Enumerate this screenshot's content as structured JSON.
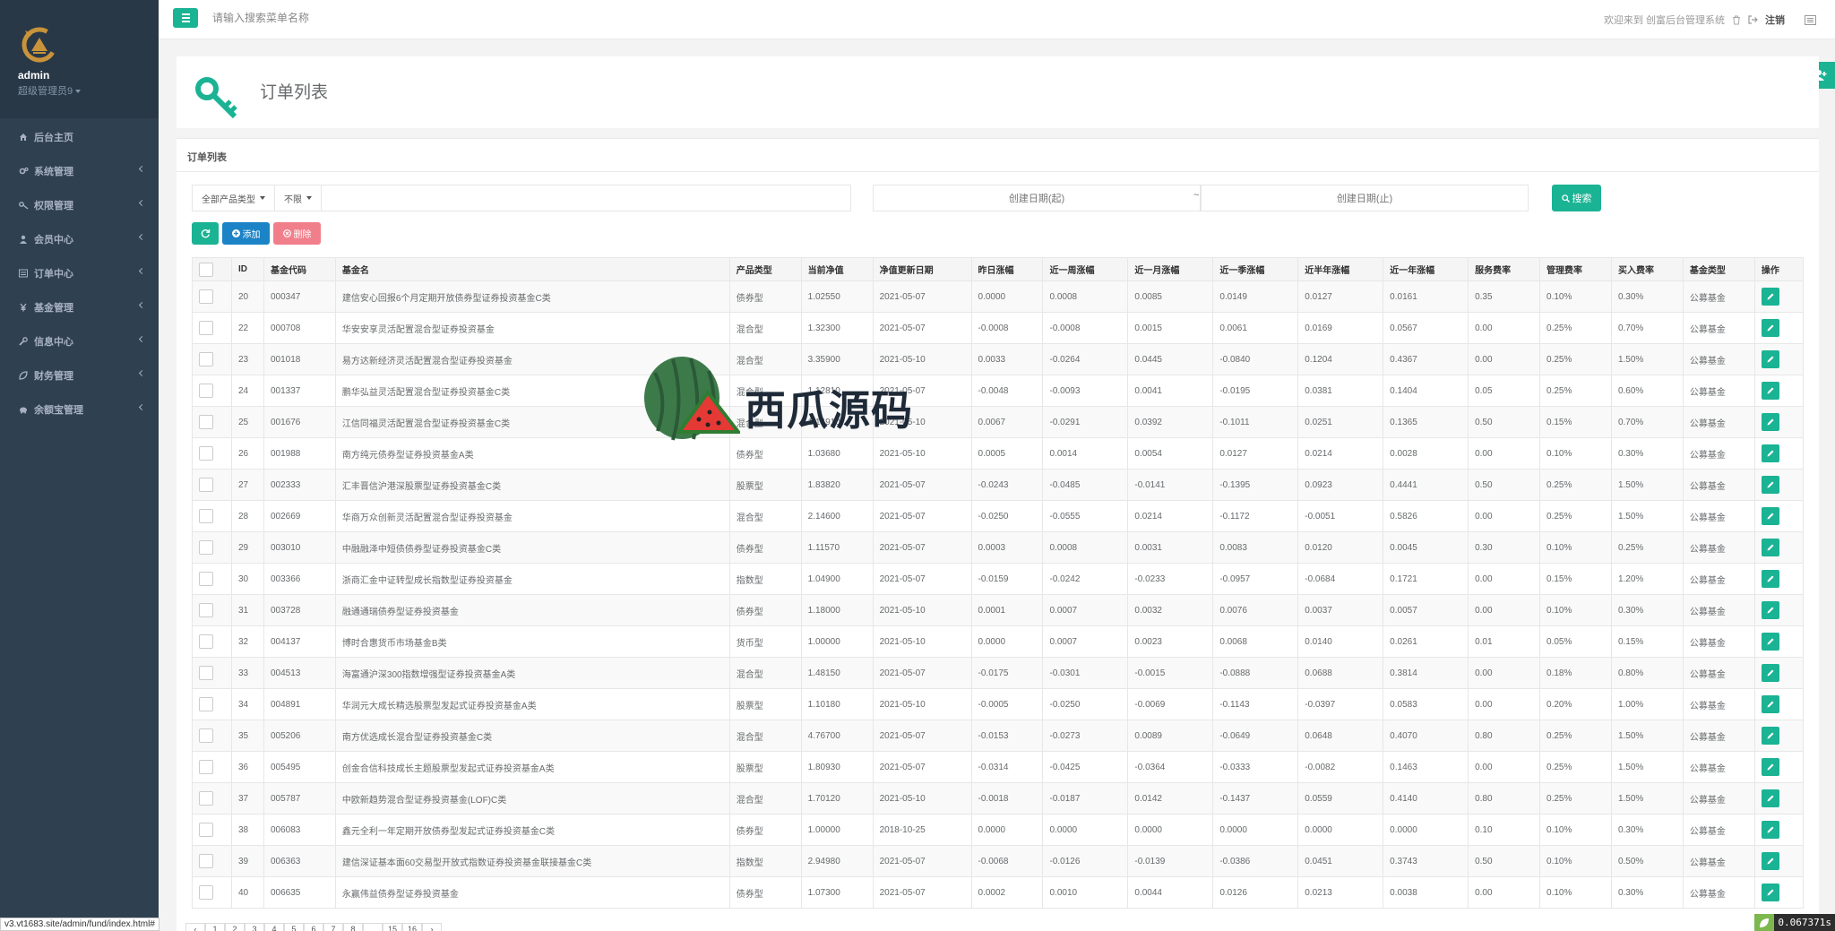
{
  "sidebar": {
    "user_name": "admin",
    "user_role": "超级管理员9",
    "items": [
      {
        "label": "后台主页",
        "icon": "home-icon",
        "chev": false
      },
      {
        "label": "系统管理",
        "icon": "cogs-icon",
        "chev": true
      },
      {
        "label": "权限管理",
        "icon": "key-icon",
        "chev": true
      },
      {
        "label": "会员中心",
        "icon": "user-icon",
        "chev": true
      },
      {
        "label": "订单中心",
        "icon": "list-icon",
        "chev": true
      },
      {
        "label": "基金管理",
        "icon": "yen-icon",
        "chev": true
      },
      {
        "label": "信息中心",
        "icon": "wrench-icon",
        "chev": true
      },
      {
        "label": "财务管理",
        "icon": "leaf-icon",
        "chev": true
      },
      {
        "label": "余额宝管理",
        "icon": "piggy-icon",
        "chev": true
      }
    ]
  },
  "status_url": "v3.vt1683.site/admin/fund/index.html#",
  "topbar": {
    "search_placeholder": "请输入搜索菜单名称",
    "welcome": "欢迎来到 创富后台管理系统",
    "logout": "注销"
  },
  "page": {
    "title": "订单列表",
    "panel_title": "订单列表"
  },
  "filters": {
    "product_type": "全部产品类型",
    "limit": "不限",
    "date_start": "创建日期(起)",
    "date_tilde": "~",
    "date_end": "创建日期(止)",
    "search_label": "搜索"
  },
  "toolbar": {
    "add_label": "添加",
    "delete_label": "删除"
  },
  "table": {
    "headers": [
      "ID",
      "基金代码",
      "基金名",
      "产品类型",
      "当前净值",
      "净值更新日期",
      "昨日涨幅",
      "近一周涨幅",
      "近一月涨幅",
      "近一季涨幅",
      "近半年涨幅",
      "近一年涨幅",
      "服务费率",
      "管理费率",
      "买入费率",
      "基金类型",
      "操作"
    ],
    "rows": [
      [
        "20",
        "000347",
        "建信安心回报6个月定期开放债券型证券投资基金C类",
        "债券型",
        "1.02550",
        "2021-05-07",
        "0.0000",
        "0.0008",
        "0.0085",
        "0.0149",
        "0.0127",
        "0.0161",
        "0.35",
        "0.10%",
        "0.30%",
        "公募基金"
      ],
      [
        "22",
        "000708",
        "华安安享灵活配置混合型证券投资基金",
        "混合型",
        "1.32300",
        "2021-05-07",
        "-0.0008",
        "-0.0008",
        "0.0015",
        "0.0061",
        "0.0169",
        "0.0567",
        "0.00",
        "0.25%",
        "0.70%",
        "公募基金"
      ],
      [
        "23",
        "001018",
        "易方达新经济灵活配置混合型证券投资基金",
        "混合型",
        "3.35900",
        "2021-05-10",
        "0.0033",
        "-0.0264",
        "0.0445",
        "-0.0840",
        "0.1204",
        "0.4367",
        "0.00",
        "0.25%",
        "1.50%",
        "公募基金"
      ],
      [
        "24",
        "001337",
        "鹏华弘益灵活配置混合型证券投资基金C类",
        "混合型",
        "1.12810",
        "2021-05-07",
        "-0.0048",
        "-0.0093",
        "0.0041",
        "-0.0195",
        "0.0381",
        "0.1404",
        "0.05",
        "0.25%",
        "0.60%",
        "公募基金"
      ],
      [
        "25",
        "001676",
        "江信同福灵活配置混合型证券投资基金C类",
        "混合型",
        "1.14910",
        "2021-05-10",
        "0.0067",
        "-0.0291",
        "0.0392",
        "-0.1011",
        "0.0251",
        "0.1365",
        "0.50",
        "0.15%",
        "0.70%",
        "公募基金"
      ],
      [
        "26",
        "001988",
        "南方纯元债券型证券投资基金A类",
        "债券型",
        "1.03680",
        "2021-05-10",
        "0.0005",
        "0.0014",
        "0.0054",
        "0.0127",
        "0.0214",
        "0.0028",
        "0.00",
        "0.10%",
        "0.30%",
        "公募基金"
      ],
      [
        "27",
        "002333",
        "汇丰晋信沪港深股票型证券投资基金C类",
        "股票型",
        "1.83820",
        "2021-05-07",
        "-0.0243",
        "-0.0485",
        "-0.0141",
        "-0.1395",
        "0.0923",
        "0.4441",
        "0.50",
        "0.25%",
        "1.50%",
        "公募基金"
      ],
      [
        "28",
        "002669",
        "华商万众创新灵活配置混合型证券投资基金",
        "混合型",
        "2.14600",
        "2021-05-07",
        "-0.0250",
        "-0.0555",
        "0.0214",
        "-0.1172",
        "-0.0051",
        "0.5826",
        "0.00",
        "0.25%",
        "1.50%",
        "公募基金"
      ],
      [
        "29",
        "003010",
        "中融融泽中短债债券型证券投资基金C类",
        "债券型",
        "1.11570",
        "2021-05-07",
        "0.0003",
        "0.0008",
        "0.0031",
        "0.0083",
        "0.0120",
        "0.0045",
        "0.30",
        "0.10%",
        "0.25%",
        "公募基金"
      ],
      [
        "30",
        "003366",
        "浙商汇金中证转型成长指数型证券投资基金",
        "指数型",
        "1.04900",
        "2021-05-07",
        "-0.0159",
        "-0.0242",
        "-0.0233",
        "-0.0957",
        "-0.0684",
        "0.1721",
        "0.00",
        "0.15%",
        "1.20%",
        "公募基金"
      ],
      [
        "31",
        "003728",
        "融通通瑞债券型证券投资基金",
        "债券型",
        "1.18000",
        "2021-05-10",
        "0.0001",
        "0.0007",
        "0.0032",
        "0.0076",
        "0.0037",
        "0.0057",
        "0.00",
        "0.10%",
        "0.30%",
        "公募基金"
      ],
      [
        "32",
        "004137",
        "博时合惠货币市场基金B类",
        "货币型",
        "1.00000",
        "2021-05-10",
        "0.0000",
        "0.0007",
        "0.0023",
        "0.0068",
        "0.0140",
        "0.0261",
        "0.01",
        "0.05%",
        "0.15%",
        "公募基金"
      ],
      [
        "33",
        "004513",
        "海富通沪深300指数增强型证券投资基金A类",
        "混合型",
        "1.48150",
        "2021-05-07",
        "-0.0175",
        "-0.0301",
        "-0.0015",
        "-0.0888",
        "0.0688",
        "0.3814",
        "0.00",
        "0.18%",
        "0.80%",
        "公募基金"
      ],
      [
        "34",
        "004891",
        "华润元大成长精选股票型发起式证券投资基金A类",
        "股票型",
        "1.10180",
        "2021-05-10",
        "-0.0005",
        "-0.0250",
        "-0.0069",
        "-0.1143",
        "-0.0397",
        "0.0583",
        "0.00",
        "0.20%",
        "1.00%",
        "公募基金"
      ],
      [
        "35",
        "005206",
        "南方优选成长混合型证券投资基金C类",
        "混合型",
        "4.76700",
        "2021-05-07",
        "-0.0153",
        "-0.0273",
        "0.0089",
        "-0.0649",
        "0.0648",
        "0.4070",
        "0.80",
        "0.25%",
        "1.50%",
        "公募基金"
      ],
      [
        "36",
        "005495",
        "创金合信科技成长主题股票型发起式证券投资基金A类",
        "股票型",
        "1.80930",
        "2021-05-07",
        "-0.0314",
        "-0.0425",
        "-0.0364",
        "-0.0333",
        "-0.0082",
        "0.1463",
        "0.00",
        "0.25%",
        "1.50%",
        "公募基金"
      ],
      [
        "37",
        "005787",
        "中欧新趋势混合型证券投资基金(LOF)C类",
        "混合型",
        "1.70120",
        "2021-05-10",
        "-0.0018",
        "-0.0187",
        "0.0142",
        "-0.1437",
        "0.0559",
        "0.4140",
        "0.80",
        "0.25%",
        "1.50%",
        "公募基金"
      ],
      [
        "38",
        "006083",
        "鑫元全利一年定期开放债券型发起式证券投资基金C类",
        "债券型",
        "1.00000",
        "2018-10-25",
        "0.0000",
        "0.0000",
        "0.0000",
        "0.0000",
        "0.0000",
        "0.0000",
        "0.10",
        "0.10%",
        "0.30%",
        "公募基金"
      ],
      [
        "39",
        "006363",
        "建信深证基本面60交易型开放式指数证券投资基金联接基金C类",
        "指数型",
        "2.94980",
        "2021-05-07",
        "-0.0068",
        "-0.0126",
        "-0.0139",
        "-0.0386",
        "0.0451",
        "0.3743",
        "0.50",
        "0.10%",
        "0.50%",
        "公募基金"
      ],
      [
        "40",
        "006635",
        "永赢伟益债券型证券投资基金",
        "债券型",
        "1.07300",
        "2021-05-07",
        "0.0002",
        "0.0010",
        "0.0044",
        "0.0126",
        "0.0213",
        "0.0038",
        "0.00",
        "0.10%",
        "0.30%",
        "公募基金"
      ]
    ]
  },
  "pagination": [
    "‹",
    "1",
    "2",
    "3",
    "4",
    "5",
    "6",
    "7",
    "8",
    "...",
    "15",
    "16",
    "›"
  ],
  "timer": "0.067371s",
  "watermark_text": "西瓜源码",
  "colors": {
    "sidebar": "#2f4050",
    "primary": "#1ab394",
    "info": "#1c84c6",
    "danger": "#ed5565"
  }
}
